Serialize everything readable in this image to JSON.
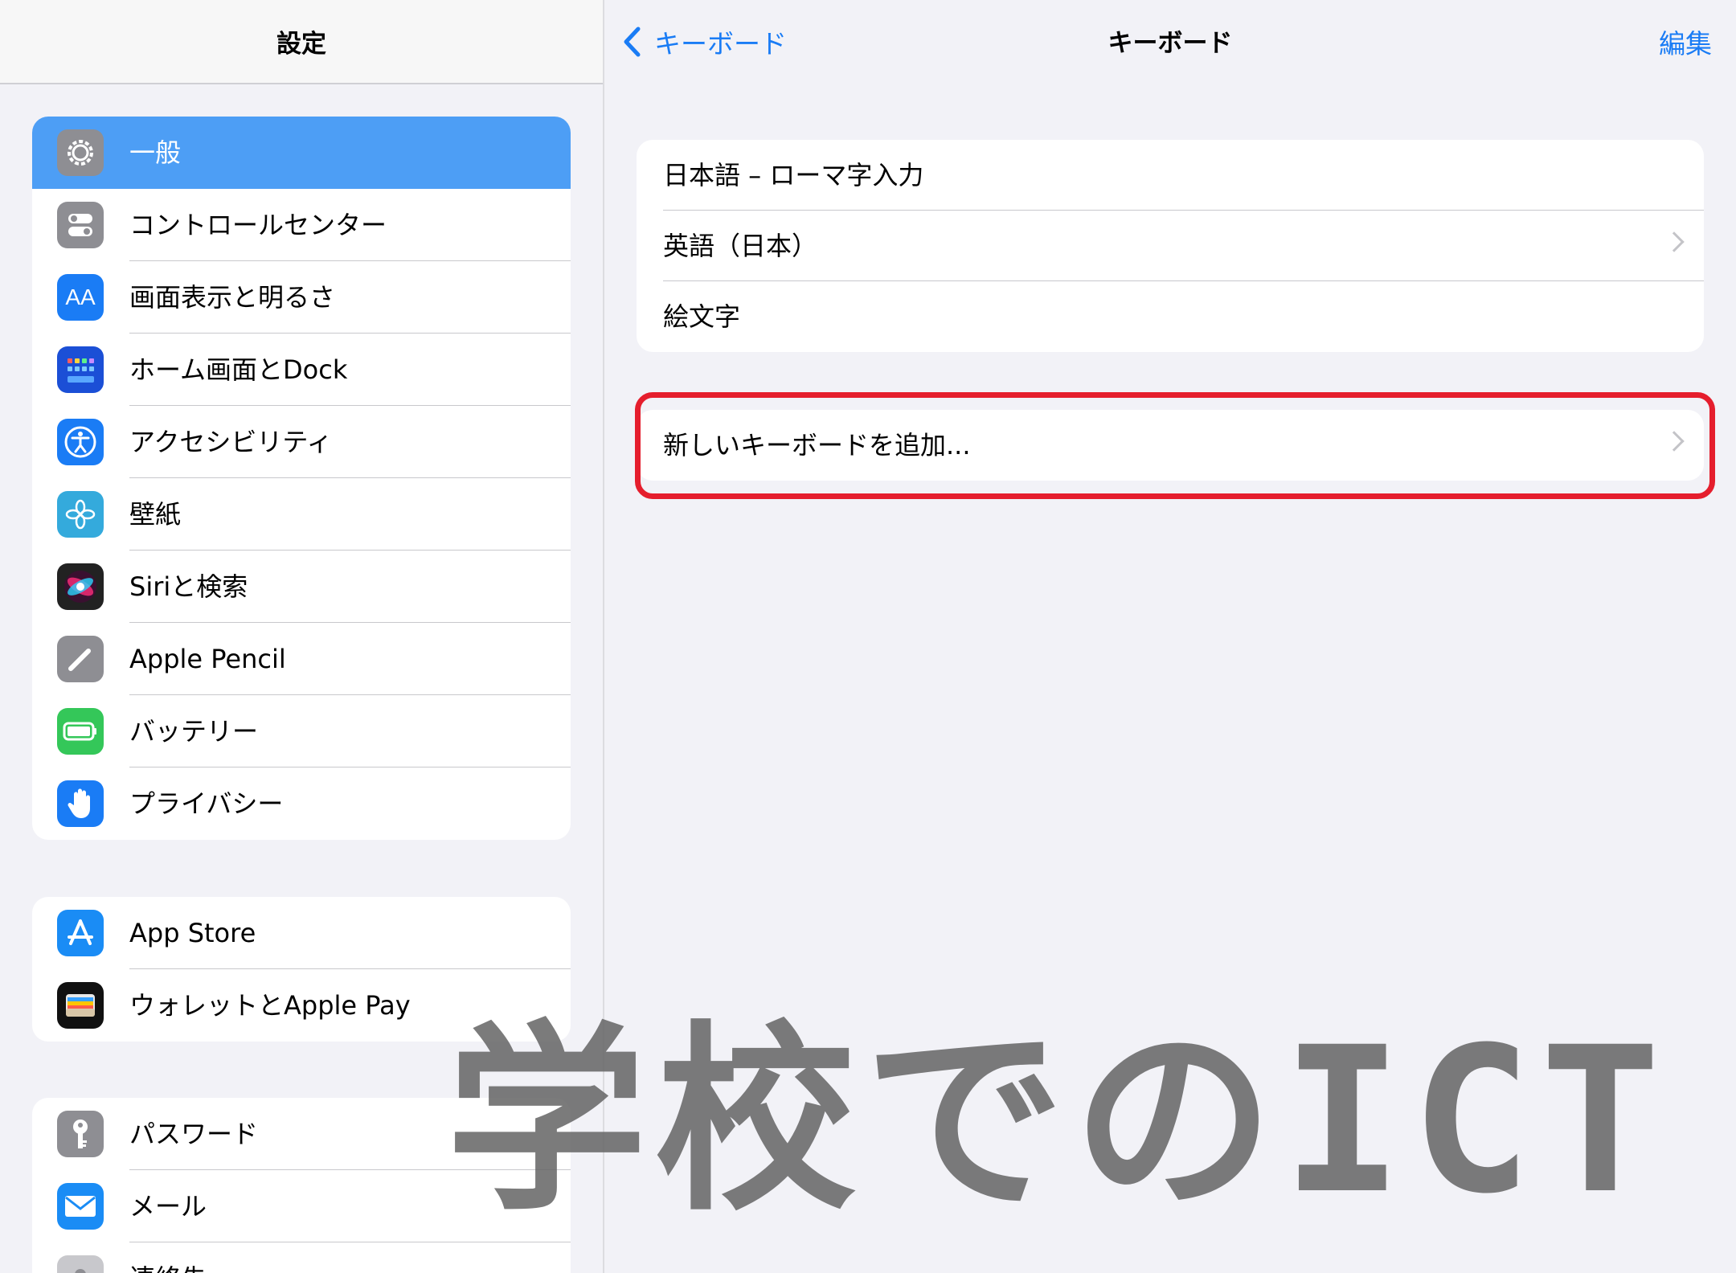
{
  "sidebar": {
    "title": "設定",
    "group1": [
      {
        "label": "一般",
        "icon": "gear-icon",
        "color": "#8e8e93",
        "selected": true
      },
      {
        "label": "コントロールセンター",
        "icon": "toggle-switches-icon",
        "color": "#8e8e93"
      },
      {
        "label": "画面表示と明るさ",
        "icon": "text-size-icon",
        "color": "#1a7cf5"
      },
      {
        "label": "ホーム画面とDock",
        "icon": "home-grid-icon",
        "color": "#1b4fd6"
      },
      {
        "label": "アクセシビリティ",
        "icon": "accessibility-icon",
        "color": "#1a7cf5"
      },
      {
        "label": "壁紙",
        "icon": "flower-icon",
        "color": "#34aadc"
      },
      {
        "label": "Siriと検索",
        "icon": "siri-icon",
        "color": "#222222"
      },
      {
        "label": "Apple Pencil",
        "icon": "pencil-icon",
        "color": "#8e8e93"
      },
      {
        "label": "バッテリー",
        "icon": "battery-icon",
        "color": "#34c759"
      },
      {
        "label": "プライバシー",
        "icon": "hand-icon",
        "color": "#1a7cf5"
      }
    ],
    "group2": [
      {
        "label": "App Store",
        "icon": "app-store-icon",
        "color": "#1a8cf5"
      },
      {
        "label": "ウォレットとApple Pay",
        "icon": "wallet-icon",
        "color": "#111111"
      }
    ],
    "group3": [
      {
        "label": "パスワード",
        "icon": "key-icon",
        "color": "#8e8e93"
      },
      {
        "label": "メール",
        "icon": "mail-icon",
        "color": "#1a8cf5"
      },
      {
        "label": "連絡先",
        "icon": "contacts-icon",
        "color": "#c8c8cc"
      }
    ]
  },
  "main": {
    "back_label": "キーボード",
    "title": "キーボード",
    "edit_label": "編集",
    "keyboards": [
      "日本語 – ローマ字入力",
      "英語（日本）",
      "絵文字"
    ],
    "add_keyboard_label": "新しいキーボードを追加..."
  },
  "watermark": "学校でのICT",
  "colors": {
    "accent": "#1a7cf5",
    "highlight": "#e51e2d",
    "selected": "#4d9ef5"
  }
}
